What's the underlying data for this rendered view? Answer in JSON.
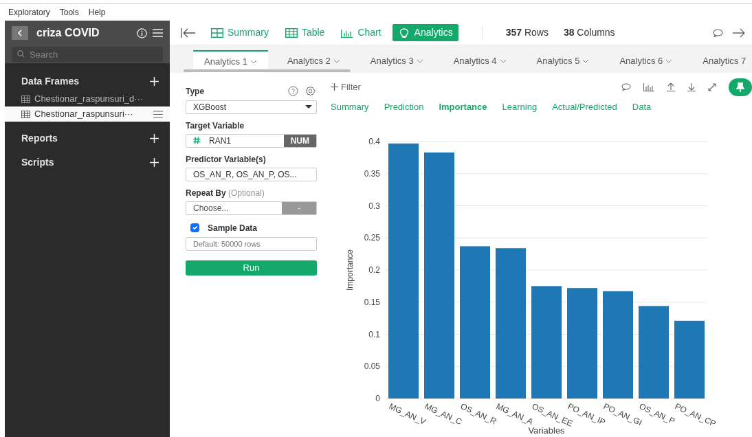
{
  "menu": [
    "Exploratory",
    "Tools",
    "Help"
  ],
  "sidebar": {
    "title": "criza COVID",
    "search": {
      "placeholder": "Search"
    },
    "sections": [
      {
        "label": "Data Frames",
        "items": [
          {
            "label": "Chestionar_raspunsuri_d···",
            "selected": false
          },
          {
            "label": "Chestionar_raspunsuri···",
            "selected": true
          }
        ]
      },
      {
        "label": "Reports"
      },
      {
        "label": "Scripts"
      }
    ]
  },
  "toolbar": {
    "views": [
      {
        "label": "Summary",
        "selected": false
      },
      {
        "label": "Table",
        "selected": false
      },
      {
        "label": "Chart",
        "selected": false
      },
      {
        "label": "Analytics",
        "selected": true
      }
    ],
    "rows_count": "357",
    "rows_label": "Rows",
    "cols_count": "38",
    "cols_label": "Columns"
  },
  "analytics_tabs": [
    {
      "label": "Analytics 1",
      "selected": true,
      "caret": true
    },
    {
      "label": "Analytics 2",
      "selected": false,
      "caret": true
    },
    {
      "label": "Analytics 3",
      "selected": false,
      "caret": true
    },
    {
      "label": "Analytics 4",
      "selected": false,
      "caret": true
    },
    {
      "label": "Analytics 5",
      "selected": false,
      "caret": true
    },
    {
      "label": "Analytics 6",
      "selected": false,
      "caret": true
    },
    {
      "label": "Analytics 7",
      "selected": false,
      "caret": false
    }
  ],
  "settings": {
    "type_label": "Type",
    "type_value": "XGBoost",
    "target_label": "Target Variable",
    "target_value": "RAN1",
    "target_badge": "NUM",
    "predictor_label": "Predictor Variable(s)",
    "predictor_value": "OS_AN_R, OS_AN_P, OS...",
    "repeat_label": "Repeat By",
    "repeat_hint": "(Optional)",
    "repeat_value": "Choose...",
    "repeat_button": "-",
    "sample_label": "Sample Data",
    "sample_checked": true,
    "sample_placeholder": "Default: 50000 rows",
    "run_button": "Run"
  },
  "filter_label": "Filter",
  "result_tabs": [
    {
      "label": "Summary",
      "selected": false
    },
    {
      "label": "Prediction",
      "selected": false
    },
    {
      "label": "Importance",
      "selected": true
    },
    {
      "label": "Learning",
      "selected": false
    },
    {
      "label": "Actual/Predicted",
      "selected": false
    },
    {
      "label": "Data",
      "selected": false
    }
  ],
  "chart_data": {
    "type": "bar",
    "xlabel": "Variables",
    "ylabel": "Importance",
    "categories": [
      "MG_AN_V",
      "MG_AN_C",
      "OS_AN_R",
      "MG_AN_A",
      "OS_AN_EE",
      "PO_AN_IP",
      "PO_AN_GI",
      "OS_AN_P",
      "PO_AN_CP"
    ],
    "values": [
      0.397,
      0.383,
      0.237,
      0.234,
      0.175,
      0.172,
      0.167,
      0.144,
      0.121
    ],
    "ylim": [
      0,
      0.4
    ],
    "grid": true,
    "yticks": [
      {
        "value": 0,
        "label": "0"
      },
      {
        "value": 0.05,
        "label": "0.05"
      },
      {
        "value": 0.1,
        "label": "0.1"
      },
      {
        "value": 0.15,
        "label": "0.15"
      },
      {
        "value": 0.2,
        "label": "0.2"
      },
      {
        "value": 0.25,
        "label": "0.25"
      },
      {
        "value": 0.3,
        "label": "0.3"
      },
      {
        "value": 0.35,
        "label": "0.35"
      },
      {
        "value": 0.4,
        "label": "0.4"
      }
    ]
  }
}
